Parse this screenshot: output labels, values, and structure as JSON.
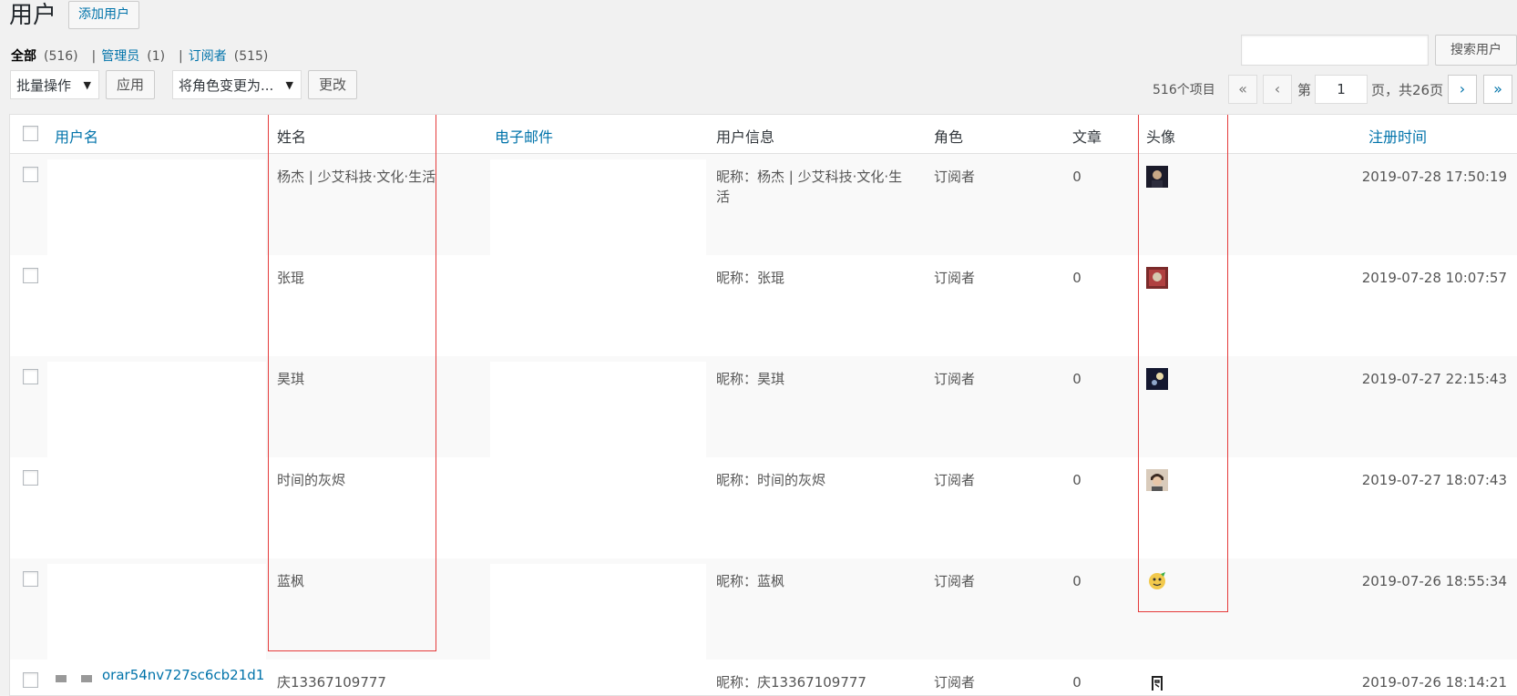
{
  "header": {
    "title": "用户",
    "add_new_label": "添加用户"
  },
  "filters": [
    {
      "label": "全部",
      "count": "(516)",
      "current": true
    },
    {
      "label": "管理员",
      "count": "(1)",
      "current": false
    },
    {
      "label": "订阅者",
      "count": "(515)",
      "current": false
    }
  ],
  "search": {
    "value": "",
    "button_label": "搜索用户"
  },
  "bulk": {
    "action_label": "批量操作",
    "apply_label": "应用",
    "role_label": "将角色变更为...",
    "change_label": "更改"
  },
  "pagination": {
    "items_count": "516个项目",
    "first": "«",
    "prev": "‹",
    "next": "›",
    "last": "»",
    "page_prefix": "第",
    "current_page": "1",
    "page_suffix": "页，共26页"
  },
  "table": {
    "columns": {
      "username": "用户名",
      "name": "姓名",
      "email": "电子邮件",
      "info": "用户信息",
      "role": "角色",
      "posts": "文章",
      "avatar": "头像",
      "registered": "注册时间"
    },
    "rows": [
      {
        "username": "",
        "name": "杨杰 | 少艾科技·文化·生活",
        "info_line1": "昵称：杨杰 | 少艾科技·文化·生",
        "info_line2": "活",
        "role": "订阅者",
        "posts": "0",
        "registered": "2019-07-28 17:50:19",
        "avatar_color": "#1b1b2a",
        "avatar_accent": "#c8a886"
      },
      {
        "username": "",
        "name": "张琨",
        "info_line1": "昵称：张琨",
        "info_line2": "",
        "role": "订阅者",
        "posts": "0",
        "registered": "2019-07-28 10:07:57",
        "avatar_color": "#7a2a2a",
        "avatar_accent": "#d6c9b0"
      },
      {
        "username": "",
        "name": "昊琪",
        "info_line1": "昵称：昊琪",
        "info_line2": "",
        "role": "订阅者",
        "posts": "0",
        "registered": "2019-07-27 22:15:43",
        "avatar_color": "#141830",
        "avatar_accent": "#e8d9a8"
      },
      {
        "username": "",
        "name": "时间的灰烬",
        "info_line1": "昵称：时间的灰烬",
        "info_line2": "",
        "role": "订阅者",
        "posts": "0",
        "registered": "2019-07-27 18:07:43",
        "avatar_color": "#d9cbbb",
        "avatar_accent": "#3a2a22"
      },
      {
        "username": "",
        "name": "蓝枫",
        "info_line1": "昵称：蓝枫",
        "info_line2": "",
        "role": "订阅者",
        "posts": "0",
        "registered": "2019-07-26 18:55:34",
        "avatar_color": "#f2c94c",
        "avatar_accent": "#3cae49"
      },
      {
        "username": "orar54nv727sc6cb21d1",
        "name": "庆13367109777",
        "info_line1": "昵称：庆13367109777",
        "info_line2": "",
        "role": "订阅者",
        "posts": "0",
        "registered": "2019-07-26 18:14:21",
        "avatar_color": "#ffffff",
        "avatar_accent": "#222222"
      }
    ]
  }
}
